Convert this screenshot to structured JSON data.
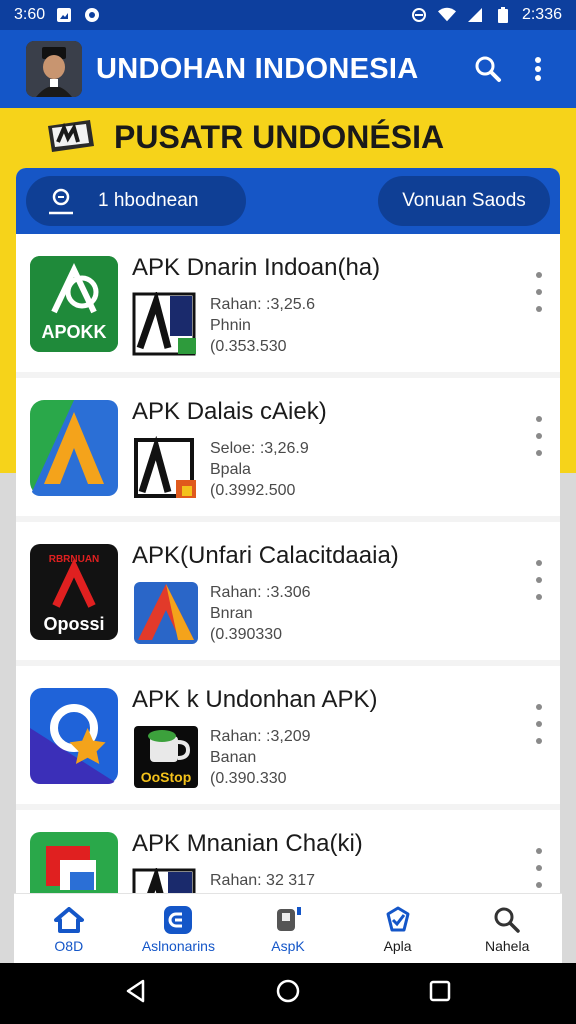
{
  "status_bar": {
    "time": "3:60",
    "battery_time": "2:336"
  },
  "app_bar": {
    "title": "UNDOHAN INDONESIA",
    "actions": [
      "search-icon",
      "more-vert-icon"
    ]
  },
  "banner": {
    "title": "PUSATR UNDONÉSIA"
  },
  "filters": {
    "left_chip": "1 hbodnean",
    "right_chip": "Vonuan Saods"
  },
  "items": [
    {
      "title": "APK Dnarin Indoan(ha)",
      "icon_text": "APOKK",
      "meta": [
        "Rahan: :3,25.6",
        "Phnin",
        "(0.353.530"
      ]
    },
    {
      "title": "APK Dalais cAiek)",
      "icon_text": "",
      "meta": [
        "Seloe: :3,26.9",
        "Bpala",
        "(0.3992.500"
      ]
    },
    {
      "title": "APK(Unfari Calacitdaaia)",
      "icon_text": "Opossi",
      "icon_top_text": "RBRNUAN",
      "meta": [
        "Rahan: :3.306",
        "Bnran",
        "(0.390330"
      ]
    },
    {
      "title": "APK k Undonhan APK)",
      "icon_text": "OoStop",
      "meta": [
        "Rahan: :3,209",
        "Banan",
        "(0.390.330"
      ]
    },
    {
      "title": "APK Mnanian Cha(ki)",
      "icon_text": "",
      "meta": [
        "Rahan: 32 317"
      ]
    }
  ],
  "bottom_nav": [
    {
      "label": "O8D",
      "icon": "home-icon",
      "active": true
    },
    {
      "label": "Aslnonarins",
      "icon": "apps-icon",
      "active": true
    },
    {
      "label": "AspK",
      "icon": "apk-icon",
      "active": true
    },
    {
      "label": "Apla",
      "icon": "check-shield-icon",
      "active": false
    },
    {
      "label": "Nahela",
      "icon": "search-icon",
      "active": false
    }
  ],
  "colors": {
    "primary": "#1456c8",
    "accent": "#f6d31a",
    "dark_blue": "#0f3f95"
  }
}
